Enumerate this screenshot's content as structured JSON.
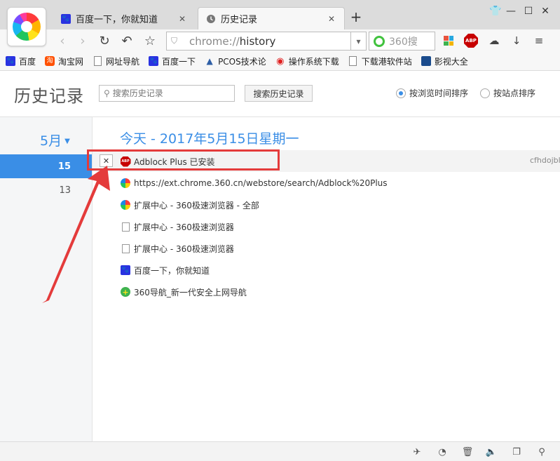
{
  "tabs": [
    {
      "title": "百度一下，你就知道",
      "favicon": "baidu-paw-icon"
    },
    {
      "title": "历史记录",
      "favicon": "history-clock-icon"
    }
  ],
  "toolbar": {
    "url_prefix": "chrome://",
    "url_main": "history",
    "search_text": "360搜"
  },
  "bookmarks": [
    {
      "label": "百度",
      "icon": "baidu-paw-icon"
    },
    {
      "label": "淘宝网",
      "icon": "taobao-icon"
    },
    {
      "label": "网址导航",
      "icon": "page-icon"
    },
    {
      "label": "百度一下",
      "icon": "baidu-paw-icon"
    },
    {
      "label": "PCOS技术论",
      "icon": "pcos-icon"
    },
    {
      "label": "操作系统下载",
      "icon": "swirl-icon"
    },
    {
      "label": "下载港软件站",
      "icon": "page-icon"
    },
    {
      "label": "影视大全",
      "icon": "film-icon"
    }
  ],
  "page": {
    "title": "历史记录",
    "search_placeholder": "搜索历史记录",
    "search_button": "搜索历史记录",
    "sort_by_time": "按浏览时间排序",
    "sort_by_site": "按站点排序",
    "sort_selected": "time"
  },
  "sidebar": {
    "month": "5月",
    "days": [
      "15",
      "13"
    ],
    "active_day": "15"
  },
  "history": {
    "date_heading": "今天 - 2017年5月15日星期一",
    "delete_label": "✕",
    "entries": [
      {
        "title": "Adblock Plus 已安装",
        "icon": "adblock-icon"
      },
      {
        "title": "https://ext.chrome.360.cn/webstore/search/Adblock%20Plus",
        "icon": "360-browser-icon"
      },
      {
        "title": "扩展中心 - 360极速浏览器 - 全部",
        "icon": "360-browser-icon"
      },
      {
        "title": "扩展中心 - 360极速浏览器",
        "icon": "page-icon"
      },
      {
        "title": "扩展中心 - 360极速浏览器",
        "icon": "page-icon"
      },
      {
        "title": "百度一下，你就知道",
        "icon": "baidu-paw-icon"
      },
      {
        "title": "360导航_新一代安全上网导航",
        "icon": "360-nav-icon"
      }
    ],
    "truncated_right_text": "cfhdojbl"
  },
  "colors": {
    "accent": "#3a8ee6",
    "annotation_red": "#e43b3b"
  }
}
